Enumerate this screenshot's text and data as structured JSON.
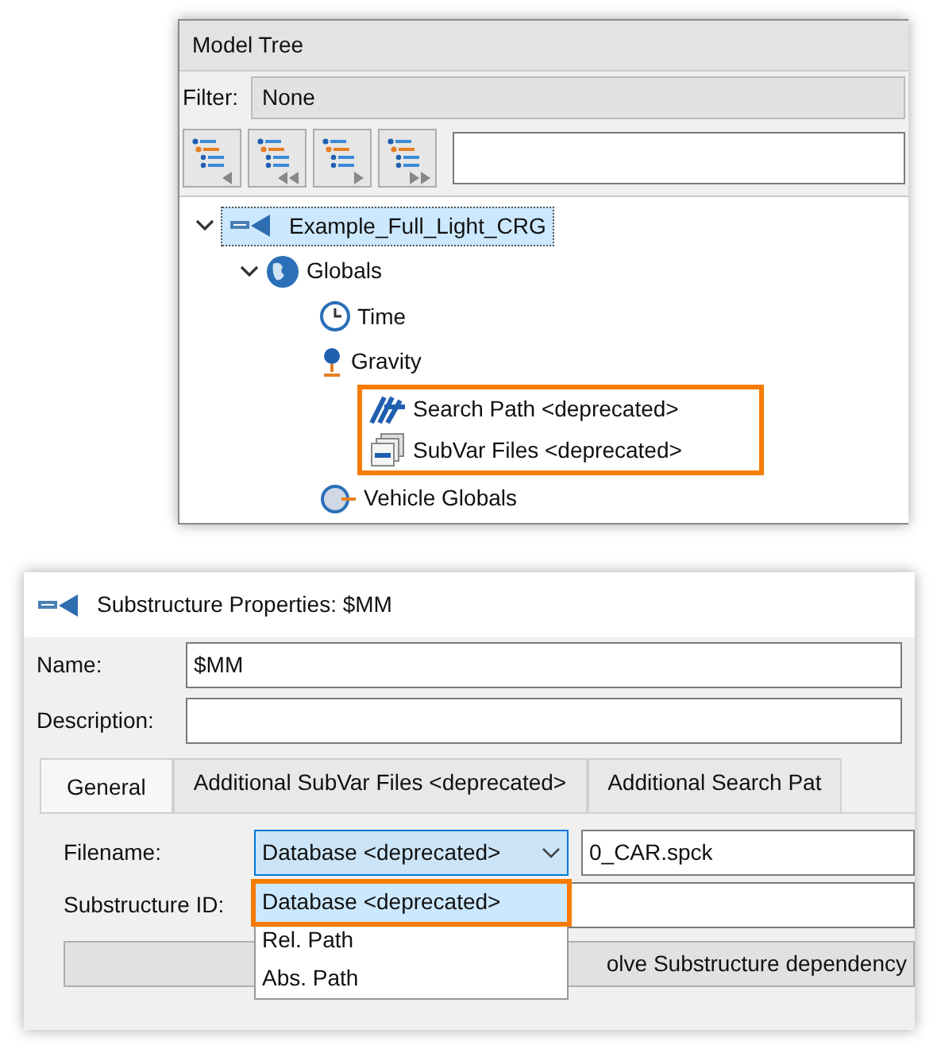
{
  "model_tree": {
    "title": "Model Tree",
    "filter": {
      "label": "Filter:",
      "value": "None"
    },
    "toolbar": [
      {
        "kind": "prev"
      },
      {
        "kind": "first"
      },
      {
        "kind": "next"
      },
      {
        "kind": "last"
      }
    ],
    "items": [
      {
        "label": "Example_Full_Light_CRG",
        "kind": "substructure",
        "expanded": true,
        "selected": true,
        "highlighted": false,
        "children": [
          {
            "label": "Globals",
            "kind": "globe",
            "expanded": true,
            "selected": false,
            "highlighted": false,
            "children": [
              {
                "label": "Time",
                "kind": "clock",
                "selected": false,
                "highlighted": false
              },
              {
                "label": "Gravity",
                "kind": "gravity",
                "selected": false,
                "highlighted": false
              },
              {
                "label": "Search Path <deprecated>",
                "kind": "path",
                "selected": false,
                "highlighted": true
              },
              {
                "label": "SubVar Files <deprecated>",
                "kind": "files",
                "selected": false,
                "highlighted": true
              },
              {
                "label": "Vehicle Globals",
                "kind": "vehicle",
                "selected": false,
                "highlighted": false
              }
            ]
          }
        ]
      }
    ]
  },
  "properties": {
    "title": "Substructure Properties: $MM",
    "fields": [
      {
        "label": "Name:",
        "value": "$MM"
      },
      {
        "label": "Description:"
      }
    ],
    "tabs": [
      {
        "label": "General",
        "selected": true
      },
      {
        "label": "Additional SubVar Files <deprecated>",
        "selected": false
      },
      {
        "label": "Additional Search Pat",
        "selected": false
      }
    ],
    "filename": {
      "label": "Filename:",
      "mode": "Database <deprecated>",
      "value": "0_CAR.spck",
      "options": [
        {
          "label": "Database <deprecated>",
          "selected": true,
          "highlighted": true
        },
        {
          "label": "Rel. Path",
          "selected": false,
          "highlighted": false
        },
        {
          "label": "Abs. Path",
          "selected": false,
          "highlighted": false
        }
      ]
    },
    "substructure_id": {
      "label": "Substructure ID:"
    },
    "button": "olve Substructure dependency"
  }
}
